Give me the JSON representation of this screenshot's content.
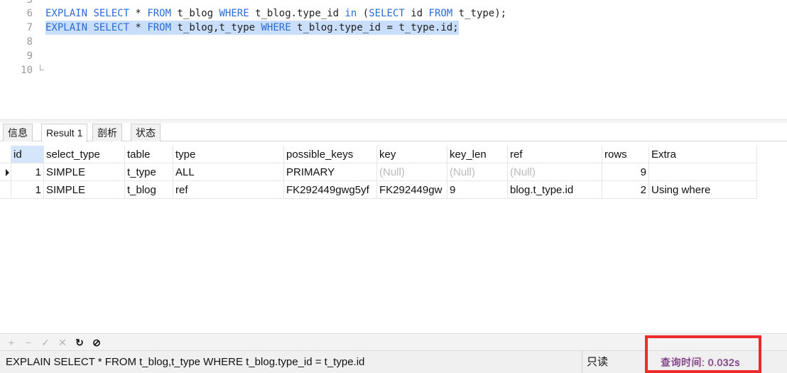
{
  "editor": {
    "lines": [
      {
        "num": "5",
        "text": ""
      },
      {
        "num": "6",
        "segments": [
          {
            "t": "EXPLAIN",
            "kw": true
          },
          {
            "t": " "
          },
          {
            "t": "SELECT",
            "kw": true
          },
          {
            "t": " * "
          },
          {
            "t": "FROM",
            "kw": true
          },
          {
            "t": " t_blog "
          },
          {
            "t": "WHERE",
            "kw": true
          },
          {
            "t": " t_blog.type_id "
          },
          {
            "t": "in",
            "kw": true
          },
          {
            "t": " ("
          },
          {
            "t": "SELECT",
            "kw": true
          },
          {
            "t": " id "
          },
          {
            "t": "FROM",
            "kw": true
          },
          {
            "t": " t_type);"
          }
        ]
      },
      {
        "num": "7",
        "selected": true,
        "segments": [
          {
            "t": "EXPLAIN",
            "kw": true
          },
          {
            "t": " "
          },
          {
            "t": "SELECT",
            "kw": true
          },
          {
            "t": " * "
          },
          {
            "t": "FROM",
            "kw": true
          },
          {
            "t": " t_blog,t_type "
          },
          {
            "t": "WHERE",
            "kw": true
          },
          {
            "t": " t_blog.type_id = t_type.id;"
          }
        ]
      },
      {
        "num": "8",
        "text": ""
      },
      {
        "num": "9",
        "text": ""
      },
      {
        "num": "10",
        "text": ""
      }
    ]
  },
  "tabs": [
    {
      "label": "信息",
      "active": false
    },
    {
      "label": "Result 1",
      "active": true
    },
    {
      "label": "剖析",
      "active": false
    },
    {
      "label": "状态",
      "active": false
    }
  ],
  "grid": {
    "columns": [
      "id",
      "select_type",
      "table",
      "type",
      "possible_keys",
      "key",
      "key_len",
      "ref",
      "rows",
      "Extra"
    ],
    "rows": [
      [
        "1",
        "SIMPLE",
        "t_type",
        "ALL",
        "PRIMARY",
        "(Null)",
        "(Null)",
        "(Null)",
        "9",
        ""
      ],
      [
        "1",
        "SIMPLE",
        "t_blog",
        "ref",
        "FK292449gwg5yf",
        "FK292449gw",
        "9",
        "blog.t_type.id",
        "2",
        "Using where"
      ]
    ],
    "current_row": 0
  },
  "toolbar": {
    "icons": [
      "add-icon",
      "remove-icon",
      "apply-icon",
      "discard-icon",
      "refresh-icon",
      "stop-icon"
    ]
  },
  "status": {
    "sql": "EXPLAIN SELECT * FROM t_blog,t_type WHERE t_blog.type_id = t_type.id",
    "mode": "只读",
    "time": "查询时间: 0.032s",
    "highlight_color": "#ee2a2a"
  }
}
